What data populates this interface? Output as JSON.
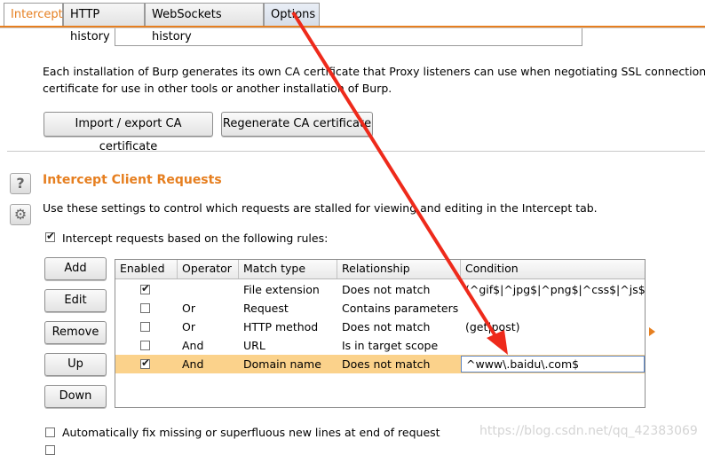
{
  "tabs": [
    {
      "label": "Intercept"
    },
    {
      "label": "HTTP history"
    },
    {
      "label": "WebSockets history"
    },
    {
      "label": "Options"
    }
  ],
  "ca": {
    "description": "Each installation of Burp generates its own CA certificate that Proxy listeners can use when negotiating SSL connections. You ca",
    "description2": "certificate for use in other tools or another installation of Burp.",
    "import_label": "Import / export CA certificate",
    "regen_label": "Regenerate CA certificate"
  },
  "intercept": {
    "title": "Intercept Client Requests",
    "description": "Use these settings to control which requests are stalled for viewing and editing in the Intercept tab.",
    "checkbox_label": "Intercept requests based on the following rules:",
    "checkbox_checked": true
  },
  "side_buttons": {
    "add": "Add",
    "edit": "Edit",
    "remove": "Remove",
    "up": "Up",
    "down": "Down"
  },
  "table": {
    "columns": [
      "Enabled",
      "Operator",
      "Match type",
      "Relationship",
      "Condition"
    ],
    "rows": [
      {
        "enabled": true,
        "operator": "",
        "match_type": "File extension",
        "relationship": "Does not match",
        "condition": "(^gif$|^jpg$|^png$|^css$|^js$|^ico$)"
      },
      {
        "enabled": false,
        "operator": "Or",
        "match_type": "Request",
        "relationship": "Contains parameters",
        "condition": ""
      },
      {
        "enabled": false,
        "operator": "Or",
        "match_type": "HTTP method",
        "relationship": "Does not match",
        "condition": "(get|post)"
      },
      {
        "enabled": false,
        "operator": "And",
        "match_type": "URL",
        "relationship": "Is in target scope",
        "condition": ""
      },
      {
        "enabled": true,
        "operator": "And",
        "match_type": "Domain name",
        "relationship": "Does not match",
        "condition": "^www\\.baidu\\.com$"
      }
    ],
    "selected_row": 4
  },
  "bottom_option": {
    "label": "Automatically fix missing or superfluous new lines at end of request",
    "checked": false
  },
  "watermark": "https://blog.csdn.net/qq_42383069",
  "colors": {
    "accent": "#e67f20",
    "selected_row": "#fbd28b",
    "annotation_arrow": "#ee2a1b"
  }
}
